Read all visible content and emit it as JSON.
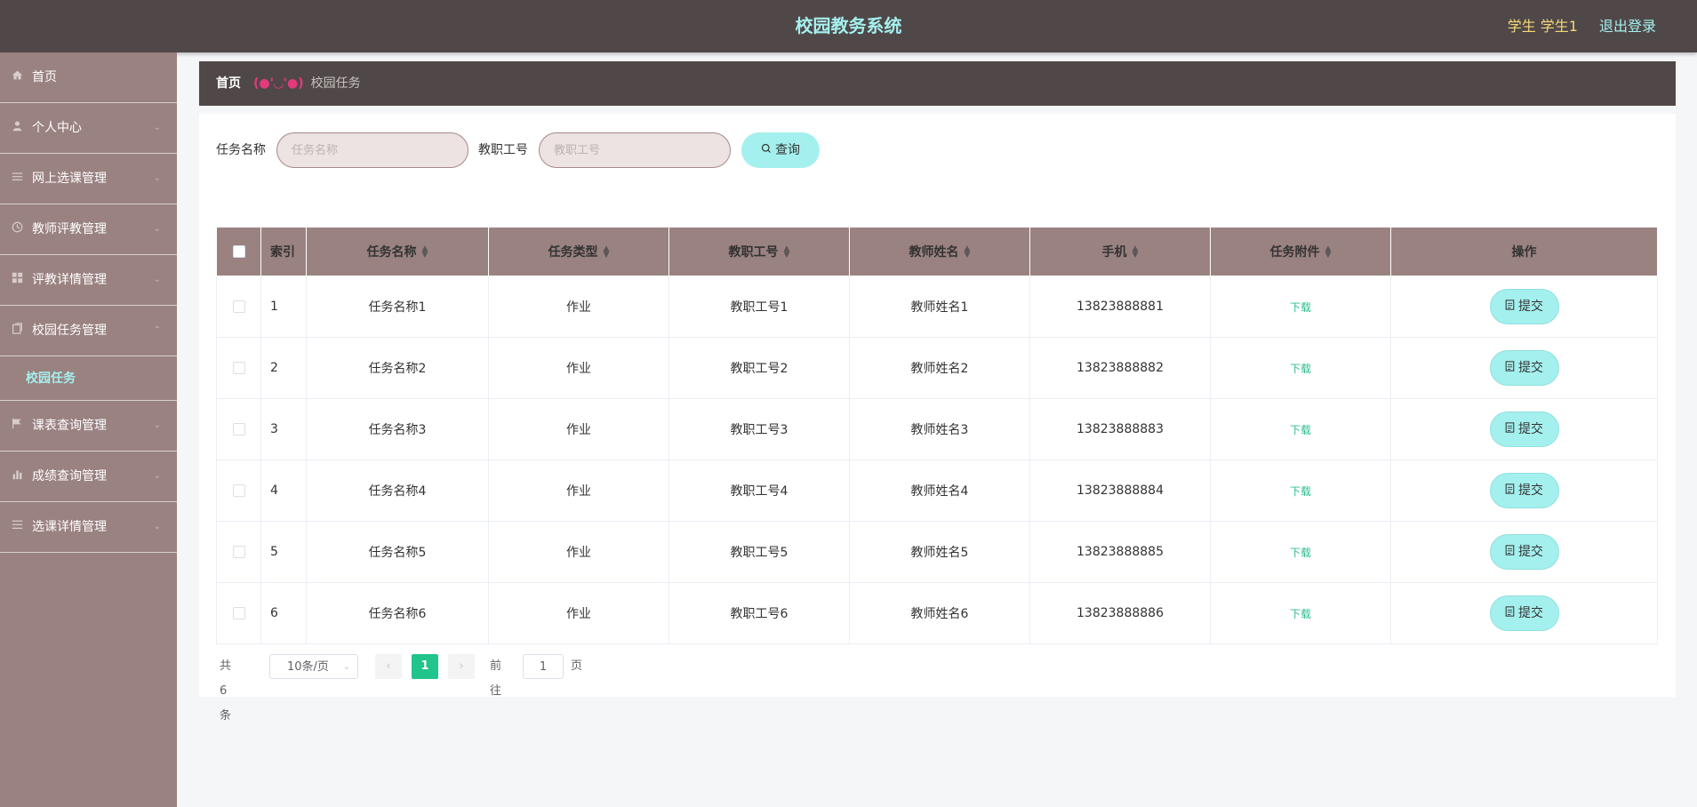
{
  "header": {
    "title": "校园教务系统",
    "user": "学生 学生1",
    "logout": "退出登录"
  },
  "sidebar": {
    "items": [
      {
        "label": "首页",
        "icon": "home-icon"
      },
      {
        "label": "个人中心",
        "icon": "user-icon"
      },
      {
        "label": "网上选课管理",
        "icon": "sliders-icon"
      },
      {
        "label": "教师评教管理",
        "icon": "clock-icon"
      },
      {
        "label": "评教详情管理",
        "icon": "grid-icon"
      },
      {
        "label": "校园任务管理",
        "icon": "document-icon"
      },
      {
        "label": "课表查询管理",
        "icon": "flag-icon"
      },
      {
        "label": "成绩查询管理",
        "icon": "bar-chart-icon"
      },
      {
        "label": "选课详情管理",
        "icon": "list-icon"
      }
    ],
    "active_sub": "校园任务"
  },
  "breadcrumb": {
    "home": "首页",
    "separator": "(●'◡'●)",
    "current": "校园任务"
  },
  "search": {
    "task_label": "任务名称",
    "task_placeholder": "任务名称",
    "staff_label": "教职工号",
    "staff_placeholder": "教职工号",
    "query_button": "查询"
  },
  "table": {
    "columns": [
      "索引",
      "任务名称",
      "任务类型",
      "教职工号",
      "教师姓名",
      "手机",
      "任务附件",
      "操作"
    ],
    "rows": [
      {
        "index": "1",
        "name": "任务名称1",
        "type": "作业",
        "staff_id": "教职工号1",
        "teacher": "教师姓名1",
        "phone": "13823888881",
        "attachment": "下载",
        "action": "提交"
      },
      {
        "index": "2",
        "name": "任务名称2",
        "type": "作业",
        "staff_id": "教职工号2",
        "teacher": "教师姓名2",
        "phone": "13823888882",
        "attachment": "下载",
        "action": "提交"
      },
      {
        "index": "3",
        "name": "任务名称3",
        "type": "作业",
        "staff_id": "教职工号3",
        "teacher": "教师姓名3",
        "phone": "13823888883",
        "attachment": "下载",
        "action": "提交"
      },
      {
        "index": "4",
        "name": "任务名称4",
        "type": "作业",
        "staff_id": "教职工号4",
        "teacher": "教师姓名4",
        "phone": "13823888884",
        "attachment": "下载",
        "action": "提交"
      },
      {
        "index": "5",
        "name": "任务名称5",
        "type": "作业",
        "staff_id": "教职工号5",
        "teacher": "教师姓名5",
        "phone": "13823888885",
        "attachment": "下载",
        "action": "提交"
      },
      {
        "index": "6",
        "name": "任务名称6",
        "type": "作业",
        "staff_id": "教职工号6",
        "teacher": "教师姓名6",
        "phone": "13823888886",
        "attachment": "下载",
        "action": "提交"
      }
    ]
  },
  "pagination": {
    "total": "共 6 条",
    "page_size": "10条/页",
    "current_page": "1",
    "goto_label": "前往",
    "goto_value": "1",
    "page_suffix": "页"
  },
  "colors": {
    "header_bg": "#504848",
    "sidebar_bg": "#9a8280",
    "accent": "#a4f0ee",
    "user_text": "#f3d97a",
    "pager_active": "#21c48b",
    "download_link": "#2cbc8f"
  }
}
